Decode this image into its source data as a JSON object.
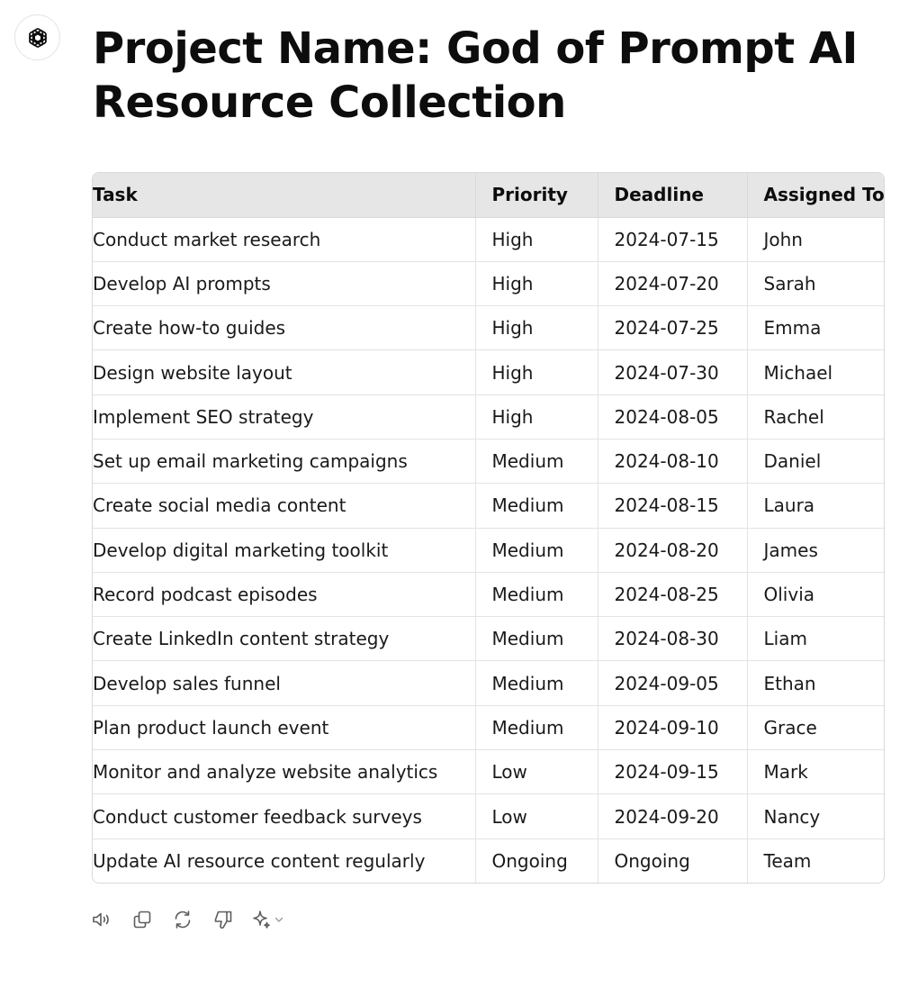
{
  "header": {
    "title": "Project Name: God of Prompt AI Resource Collection",
    "avatar_icon": "openai-logo-icon"
  },
  "table": {
    "columns": [
      "Task",
      "Priority",
      "Deadline",
      "Assigned To"
    ],
    "rows": [
      [
        "Conduct market research",
        "High",
        "2024-07-15",
        "John"
      ],
      [
        "Develop AI prompts",
        "High",
        "2024-07-20",
        "Sarah"
      ],
      [
        "Create how-to guides",
        "High",
        "2024-07-25",
        "Emma"
      ],
      [
        "Design website layout",
        "High",
        "2024-07-30",
        "Michael"
      ],
      [
        "Implement SEO strategy",
        "High",
        "2024-08-05",
        "Rachel"
      ],
      [
        "Set up email marketing campaigns",
        "Medium",
        "2024-08-10",
        "Daniel"
      ],
      [
        "Create social media content",
        "Medium",
        "2024-08-15",
        "Laura"
      ],
      [
        "Develop digital marketing toolkit",
        "Medium",
        "2024-08-20",
        "James"
      ],
      [
        "Record podcast episodes",
        "Medium",
        "2024-08-25",
        "Olivia"
      ],
      [
        "Create LinkedIn content strategy",
        "Medium",
        "2024-08-30",
        "Liam"
      ],
      [
        "Develop sales funnel",
        "Medium",
        "2024-09-05",
        "Ethan"
      ],
      [
        "Plan product launch event",
        "Medium",
        "2024-09-10",
        "Grace"
      ],
      [
        "Monitor and analyze website analytics",
        "Low",
        "2024-09-15",
        "Mark"
      ],
      [
        "Conduct customer feedback surveys",
        "Low",
        "2024-09-20",
        "Nancy"
      ],
      [
        "Update AI resource content regularly",
        "Ongoing",
        "Ongoing",
        "Team"
      ]
    ]
  },
  "actions": {
    "icons": [
      "read-aloud-icon",
      "copy-icon",
      "regenerate-icon",
      "thumbs-down-icon",
      "sparkle-model-icon",
      "chevron-down-icon"
    ],
    "icon_color": "#5d5d5d"
  }
}
